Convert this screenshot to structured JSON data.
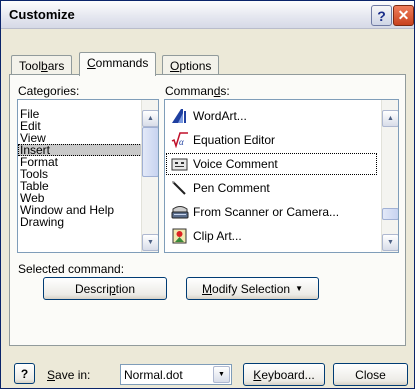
{
  "window": {
    "title": "Customize"
  },
  "tabs": [
    {
      "pre": "Tool",
      "u": "b",
      "post": "ars"
    },
    {
      "pre": "",
      "u": "C",
      "post": "ommands"
    },
    {
      "pre": "",
      "u": "O",
      "post": "ptions"
    }
  ],
  "categories": {
    "label_pre": "Cate",
    "label_u": "g",
    "label_post": "ories:",
    "items": [
      "File",
      "Edit",
      "View",
      "Insert",
      "Format",
      "Tools",
      "Table",
      "Web",
      "Window and Help",
      "Drawing"
    ],
    "selected": "Insert"
  },
  "commands": {
    "label_pre": "Comman",
    "label_u": "d",
    "label_post": "s:",
    "items": [
      {
        "label": "WordArt...",
        "icon": "wordart-icon"
      },
      {
        "label": "Equation Editor",
        "icon": "equation-icon"
      },
      {
        "label": "Voice Comment",
        "icon": "voice-comment-icon"
      },
      {
        "label": "Pen Comment",
        "icon": "pen-icon"
      },
      {
        "label": "From Scanner or Camera...",
        "icon": "scanner-icon"
      },
      {
        "label": "Clip Art...",
        "icon": "clip-art-icon"
      }
    ],
    "focused": "Voice Comment"
  },
  "selected_command": {
    "label": "Selected command:",
    "description_pre": "Descri",
    "description_u": "p",
    "description_post": "tion",
    "modify_pre": "",
    "modify_u": "M",
    "modify_post": "odify Selection"
  },
  "bottom": {
    "save_in_pre": "",
    "save_in_u": "S",
    "save_in_post": "ave in:",
    "save_in_value": "Normal.dot",
    "keyboard_pre": "",
    "keyboard_u": "K",
    "keyboard_post": "eyboard...",
    "close_label": "Close"
  }
}
